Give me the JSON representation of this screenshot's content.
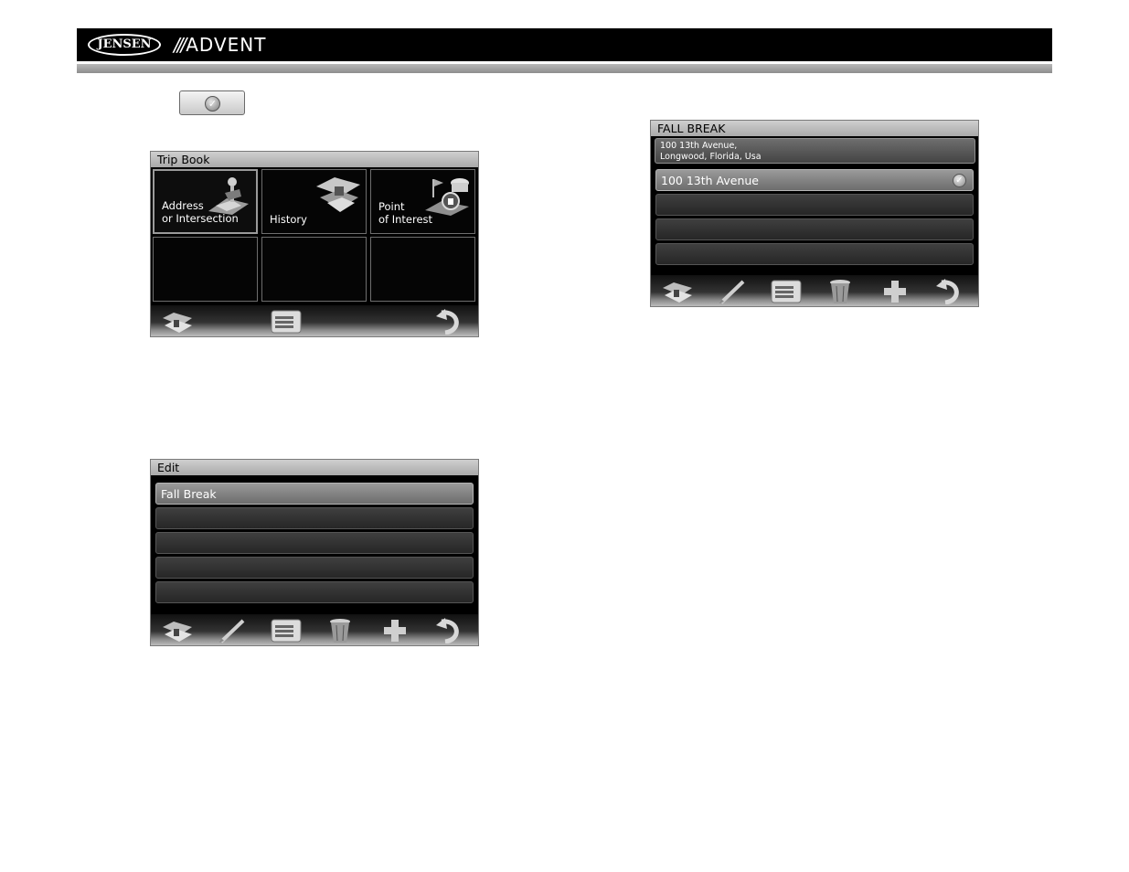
{
  "header": {
    "brand_left": "JENSEN",
    "brand_right_slashes": "///",
    "brand_right": "ADVENT"
  },
  "ok_button": {
    "icon": "check-icon"
  },
  "trip_book": {
    "title": "Trip Book",
    "cells": [
      {
        "line1": "Address",
        "line2": "or Intersection",
        "icon": "map-pin-icon",
        "selected": true
      },
      {
        "line1": "",
        "line2": "History",
        "icon": "history-map-icon",
        "selected": false
      },
      {
        "line1": "Point",
        "line2": "of Interest",
        "icon": "poi-icon",
        "selected": false
      },
      {
        "line1": "",
        "line2": "",
        "icon": "",
        "selected": false
      },
      {
        "line1": "",
        "line2": "",
        "icon": "",
        "selected": false
      },
      {
        "line1": "",
        "line2": "",
        "icon": "",
        "selected": false
      }
    ],
    "toolbar": [
      "map-icon",
      "list-icon",
      "back-icon"
    ]
  },
  "edit": {
    "title": "Edit",
    "rows": [
      "Fall Break",
      "",
      "",
      "",
      ""
    ],
    "toolbar": [
      "map-icon",
      "pencil-icon",
      "list-icon",
      "trash-icon",
      "plus-icon",
      "back-icon"
    ]
  },
  "fall_break": {
    "title": "FALL BREAK",
    "address_line1": "100 13th Avenue,",
    "address_line2": "Longwood, Florida, Usa",
    "rows": [
      "100 13th Avenue",
      "",
      "",
      ""
    ],
    "toolbar": [
      "map-icon",
      "pencil-icon",
      "list-icon",
      "trash-icon",
      "plus-icon",
      "back-icon"
    ]
  }
}
